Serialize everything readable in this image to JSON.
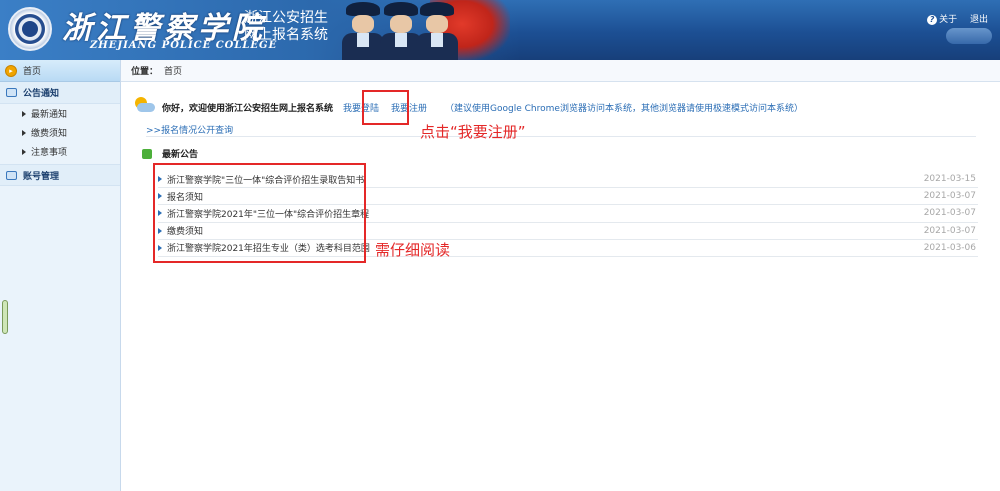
{
  "header": {
    "school_calligraphy": "浙江警察学院",
    "school_english": "ZHEJIANG POLICE COLLEGE",
    "system_title_line1": "浙江公安招生",
    "system_title_line2": "网上报名系统",
    "about_label": "关于",
    "logout_label": "退出",
    "about_icon": "question-icon"
  },
  "sidebar": {
    "home_label": "首页",
    "groups": [
      {
        "label": "公告通知",
        "items": [
          "最新通知",
          "缴费须知",
          "注意事项"
        ]
      },
      {
        "label": "账号管理",
        "items": []
      }
    ]
  },
  "breadcrumb": {
    "label": "位置：",
    "current": "首页"
  },
  "welcome": {
    "greeting": "你好，欢迎使用浙江公安招生网上报名系统",
    "login_link": "我要登陆",
    "register_link": "我要注册",
    "browser_note": "（建议使用Google Chrome浏览器访问本系统，其他浏览器请使用极速模式访问本系统）",
    "progress_link": ">>报名情况公开查询"
  },
  "notices": {
    "title": "最新公告",
    "items": [
      {
        "title": "浙江警察学院\"三位一体\"综合评价招生录取告知书",
        "date": "2021-03-15"
      },
      {
        "title": "报名须知",
        "date": "2021-03-07"
      },
      {
        "title": "浙江警察学院2021年\"三位一体\"综合评价招生章程",
        "date": "2021-03-07"
      },
      {
        "title": "缴费须知",
        "date": "2021-03-07"
      },
      {
        "title": "浙江警察学院2021年招生专业（类）选考科目范围",
        "date": "2021-03-06"
      }
    ]
  },
  "annotations": {
    "register_hint": "点击“我要注册”",
    "read_hint": "需仔细阅读",
    "color": "#e42828"
  },
  "colors": {
    "header_blue": "#1c4f93",
    "link_blue": "#2a6db5",
    "sidebar_bg": "#eaf3fb"
  }
}
